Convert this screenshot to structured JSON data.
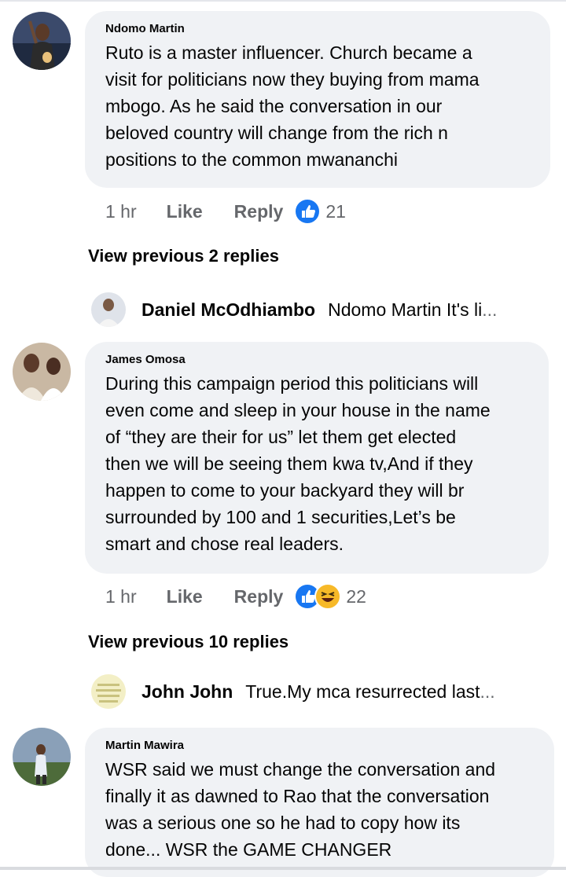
{
  "colors": {
    "bubble": "#f0f2f5",
    "secondary_text": "#65676b",
    "like_blue": "#1877f2",
    "haha_yellow": "#f7b928"
  },
  "labels": {
    "like": "Like",
    "reply": "Reply"
  },
  "comments": [
    {
      "author": "Ndomo Martin",
      "text": "Ruto is a master influencer. Church became a\nvisit for politicians now they buying from mama\nmbogo.  As he said the conversation in our\nbeloved country will change from the rich n\npositions to the common mwananchi",
      "time": "1 hr",
      "reactions": [
        "like-icon"
      ],
      "reaction_count": "21",
      "view_previous": "View previous 2 replies",
      "latest_reply": {
        "author": "Daniel McOdhiambo",
        "text": "Ndomo Martin It's li",
        "ellipsis": "..."
      }
    },
    {
      "author": "James Omosa",
      "text": "During this campaign period this politicians will\neven come and sleep in your house in the name\nof “they are their for us” let them get elected\nthen we will be seeing them kwa tv,And if they\nhappen to come to your backyard they will br\nsurrounded by 100 and 1 securities,Let’s be\nsmart and chose real leaders.",
      "time": "1 hr",
      "reactions": [
        "like-icon",
        "haha-icon"
      ],
      "reaction_count": "22",
      "view_previous": "View previous 10 replies",
      "latest_reply": {
        "author": "John John",
        "text": "True.My mca resurrected last ",
        "ellipsis": "..."
      }
    },
    {
      "author": "Martin Mawira",
      "text": "WSR said we must change the conversation and\nfinally it as dawned to Rao that the conversation\nwas a serious one so he had to copy how its\ndone... WSR the GAME CHANGER"
    }
  ]
}
